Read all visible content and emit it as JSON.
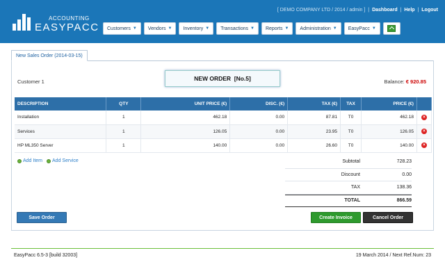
{
  "header": {
    "logo_top": "ACCOUNTING",
    "logo_name": "EASYPACC",
    "company_info": "[ DEMO COMPANY LTD / 2014 / admin ]",
    "links": [
      "Dashboard",
      "Help",
      "Logout"
    ],
    "nav": [
      "Customers",
      "Vendors",
      "Inventory",
      "Transactions",
      "Reports",
      "Administration",
      "EasyPacc"
    ],
    "accent": "#1b76b8"
  },
  "tab": {
    "label": "New Sales Order (2014-03-15)"
  },
  "order": {
    "customer": "Customer 1",
    "title": "NEW ORDER",
    "number": "[No.5]",
    "balance_label": "Balance:",
    "balance_value": "€ 920.85"
  },
  "table": {
    "headers": [
      "DESCRIPTION",
      "QTY",
      "UNIT PRICE (€)",
      "DISC. (€)",
      "TAX (€)",
      "TAX",
      "PRICE (€)"
    ],
    "rows": [
      {
        "desc": "Installation",
        "qty": "1",
        "unit": "462.18",
        "disc": "0.00",
        "tax": "87.81",
        "taxc": "T0",
        "price": "462.18"
      },
      {
        "desc": "Services",
        "qty": "1",
        "unit": "126.05",
        "disc": "0.00",
        "tax": "23.95",
        "taxc": "T0",
        "price": "126.05"
      },
      {
        "desc": "HP ML350 Server",
        "qty": "1",
        "unit": "140.00",
        "disc": "0.00",
        "tax": "26.60",
        "taxc": "T0",
        "price": "140.00"
      }
    ]
  },
  "links": {
    "add_item": "Add Item",
    "add_service": "Add Service"
  },
  "totals": {
    "subtotal_label": "Subtotal",
    "subtotal": "728.23",
    "discount_label": "Discount",
    "discount": "0.00",
    "tax_label": "TAX",
    "tax": "138.36",
    "total_label": "TOTAL",
    "total": "866.59"
  },
  "buttons": {
    "save": "Save Order",
    "create": "Create Invoice",
    "cancel": "Cancel Order"
  },
  "footer": {
    "version": "EasyPacc 6.5-3 [build 32003]",
    "info": "19 March 2014 / Next Ref.Num: 23"
  }
}
